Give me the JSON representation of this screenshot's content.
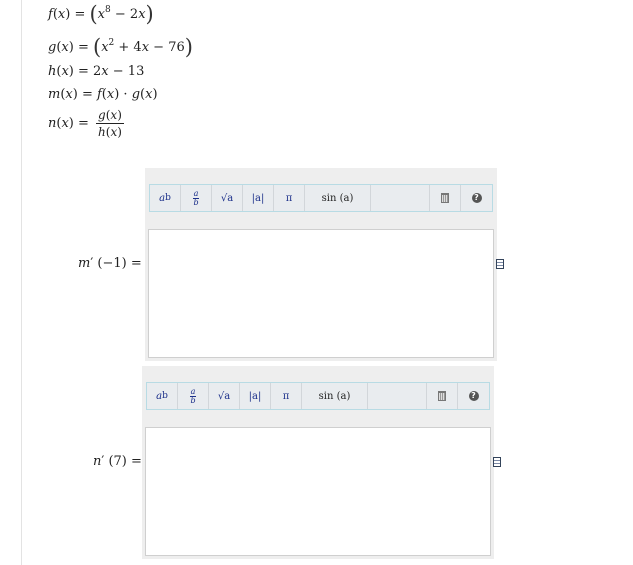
{
  "functions": {
    "f": {
      "name": "f",
      "var": "x",
      "lhs_tail": ") = ",
      "inner_a": "x",
      "exp": "8",
      "inner_b": " − 2",
      "inner_c": "x"
    },
    "g": {
      "name": "g",
      "var": "x",
      "lhs_tail": ") = ",
      "inner_a": "x",
      "exp": "2",
      "inner_b": " + 4",
      "inner_c": "x",
      "inner_d": " − 76"
    },
    "h": {
      "name": "h",
      "var": "x",
      "lhs_tail": ") = 2",
      "rhs_var": "x",
      "rhs_tail": " − 13"
    },
    "m": {
      "name": "m",
      "var": "x",
      "lhs_tail": ")  =  ",
      "f": "f",
      "g": "g",
      "dot": ") · "
    },
    "n": {
      "name": "n",
      "var": "x",
      "lhs_tail": ")  = ",
      "num_fn": "g",
      "den_fn": "h"
    }
  },
  "toolbar": {
    "power_base": "a",
    "power_exp": "b",
    "frac_num": "a",
    "frac_den": "b",
    "sqrt_label": "√a",
    "abs_label": "|a|",
    "pi_label": "π",
    "sin_label": "sin (a)",
    "help_label": "?"
  },
  "questions": [
    {
      "fn": "m",
      "arg": "(−1) ="
    },
    {
      "fn": "n",
      "arg": "(7) ="
    }
  ],
  "colors": {
    "toolbar_border": "#b8dbe4",
    "toolbar_text": "#1b2f8a",
    "panel_bg": "#eeeeee"
  }
}
